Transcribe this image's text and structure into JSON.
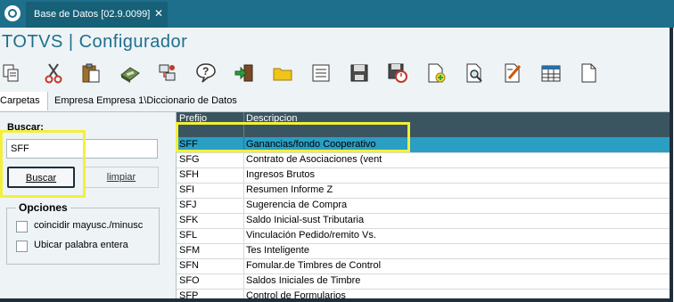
{
  "window": {
    "tab_title": "Base de Datos [02.9.0099]",
    "tab_close": "✕"
  },
  "app": {
    "title": "TOTVS | Configurador"
  },
  "toolbar": {
    "buttons": [
      "copy-icon",
      "cut-icon",
      "paste-icon",
      "calculator-icon",
      "connect-icon",
      "help-icon",
      "exit-icon",
      "folder-icon",
      "list-icon",
      "save-icon",
      "save-record-icon",
      "add-page-icon",
      "preview-icon",
      "edit-icon",
      "table-icon",
      "document-icon"
    ]
  },
  "nav": {
    "carpetas": "Carpetas",
    "path": "Empresa Empresa 1\\Diccionario de Datos"
  },
  "search": {
    "label": "Buscar:",
    "value": "SFF",
    "buscar_button": "Buscar",
    "limpiar_button": "limpiar"
  },
  "options": {
    "title": "Opciones",
    "items": [
      "coincidir mayusc./minusc",
      "Ubicar palabra entera"
    ]
  },
  "grid": {
    "columns": [
      "Prefijo",
      "Descripcion"
    ],
    "rows": [
      {
        "prefix": "SFF",
        "desc": "Ganancias/fondo Cooperativo"
      },
      {
        "prefix": "SFG",
        "desc": "Contrato de Asociaciones (vent"
      },
      {
        "prefix": "SFH",
        "desc": "Ingresos Brutos"
      },
      {
        "prefix": "SFI",
        "desc": "Resumen Informe Z"
      },
      {
        "prefix": "SFJ",
        "desc": "Sugerencia de Compra"
      },
      {
        "prefix": "SFK",
        "desc": "Saldo Inicial-sust Tributaria"
      },
      {
        "prefix": "SFL",
        "desc": "Vinculación Pedido/remito Vs."
      },
      {
        "prefix": "SFM",
        "desc": "Tes Inteligente"
      },
      {
        "prefix": "SFN",
        "desc": "Fomular.de Timbres de Control"
      },
      {
        "prefix": "SFO",
        "desc": "Saldos Iniciales de Timbre"
      },
      {
        "prefix": "SFP",
        "desc": "Control de Formularios"
      }
    ]
  },
  "colors": {
    "titlebar": "#1e6f8b",
    "selected_row": "#2a9ec3",
    "highlight": "#f2f03a"
  }
}
